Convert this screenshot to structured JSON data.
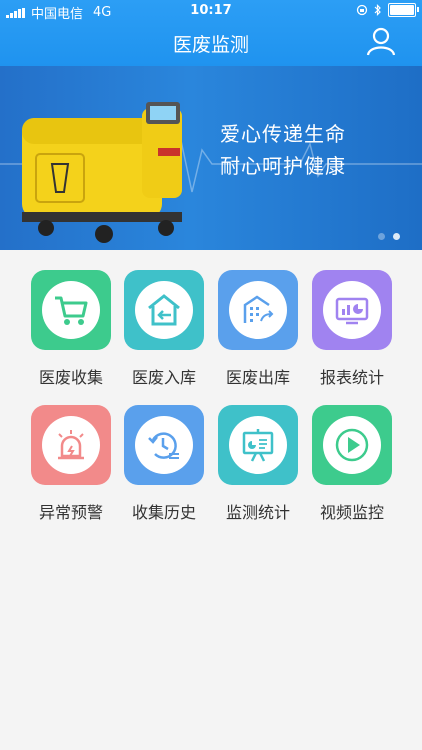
{
  "status_bar": {
    "carrier": "中国电信",
    "network": "4G",
    "time": "10:17"
  },
  "header": {
    "title": "医废监测"
  },
  "banner": {
    "line1": "爱心传递生命",
    "line2": "耐心呵护健康"
  },
  "menu": [
    {
      "label": "医废收集",
      "icon": "cart-icon",
      "color": "#3dcb8d"
    },
    {
      "label": "医废入库",
      "icon": "warehouse-in-icon",
      "color": "#3fc1c9"
    },
    {
      "label": "医废出库",
      "icon": "building-out-icon",
      "color": "#5aa0ec"
    },
    {
      "label": "报表统计",
      "icon": "report-icon",
      "color": "#a083f0"
    },
    {
      "label": "异常预警",
      "icon": "alarm-icon",
      "color": "#f28a8a"
    },
    {
      "label": "收集历史",
      "icon": "history-icon",
      "color": "#5aa0ec"
    },
    {
      "label": "监测统计",
      "icon": "presentation-icon",
      "color": "#3fc1c9"
    },
    {
      "label": "视频监控",
      "icon": "video-icon",
      "color": "#3dcb8d"
    }
  ]
}
